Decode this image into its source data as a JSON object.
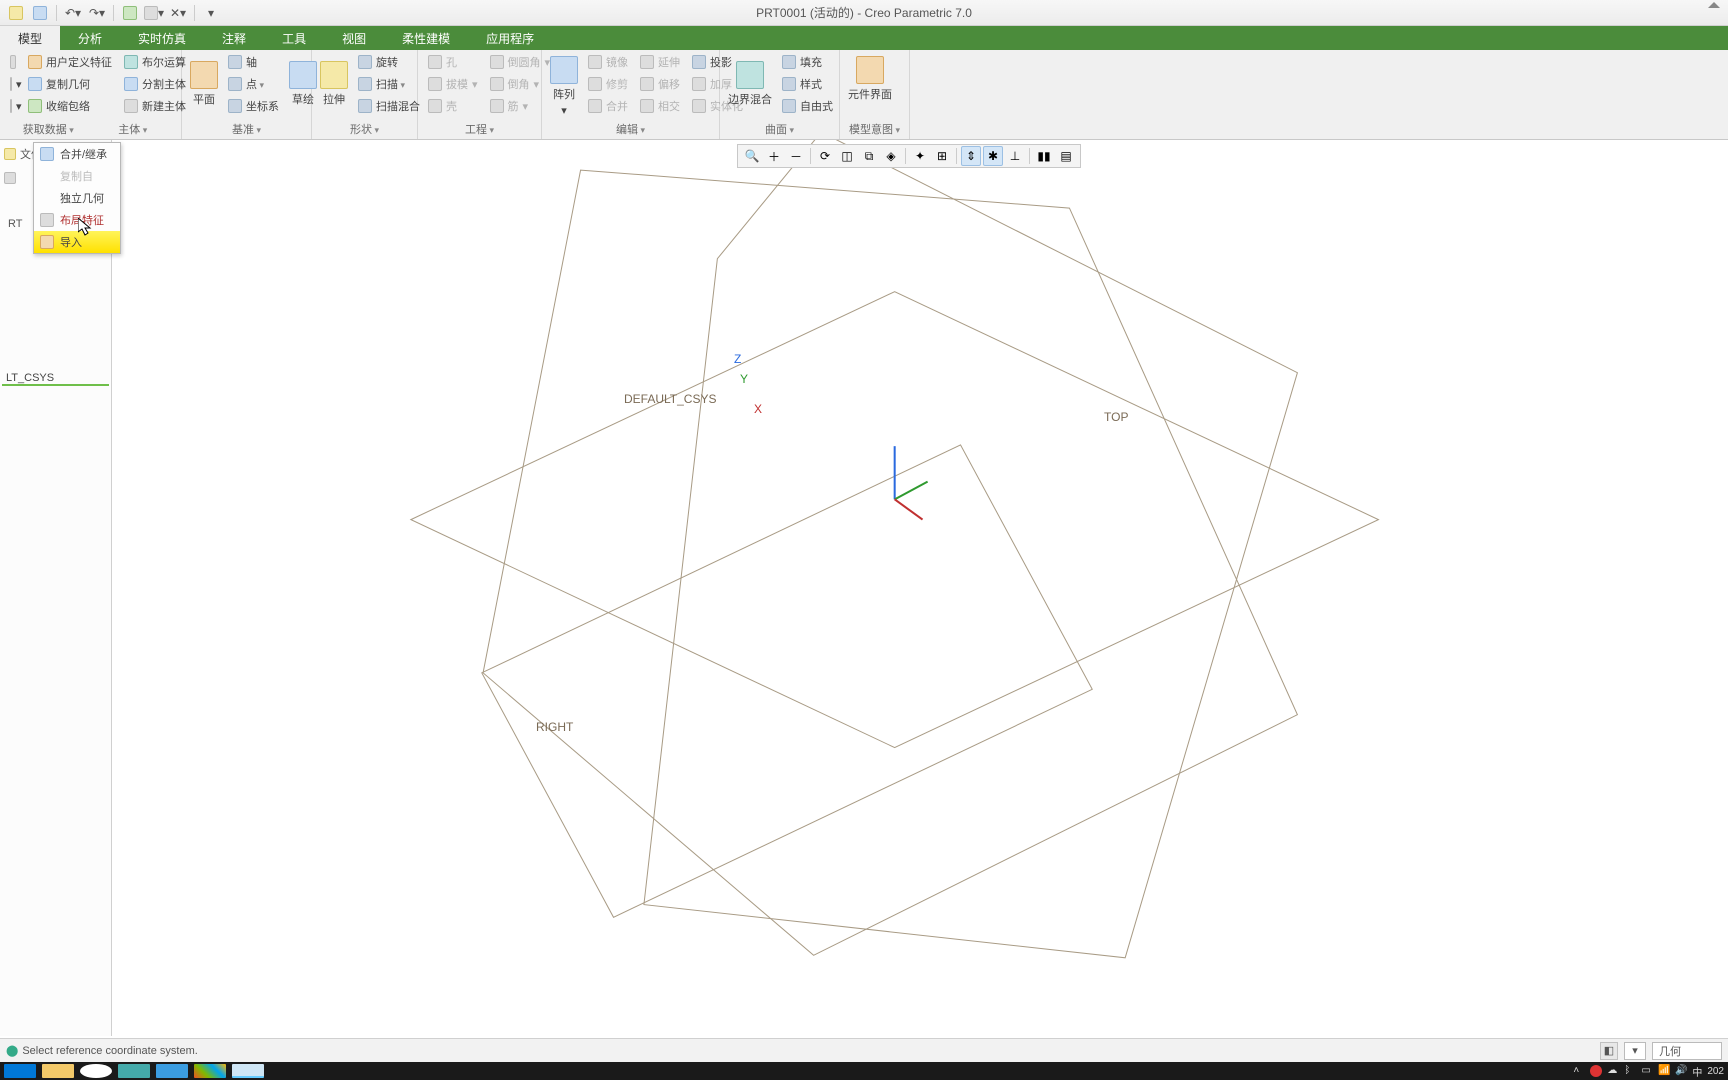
{
  "app": {
    "title": "PRT0001 (活动的) - Creo Parametric 7.0"
  },
  "tabs": {
    "items": [
      "模型",
      "分析",
      "实时仿真",
      "注释",
      "工具",
      "视图",
      "柔性建模",
      "应用程序"
    ],
    "active_index": 0
  },
  "ribbon": {
    "g0": {
      "r0": "用户定义特征",
      "r1": "复制几何",
      "r2": "收缩包络",
      "c0": "布尔运算",
      "c1": "分割主体",
      "c2": "新建主体",
      "label": "获取数据",
      "label2": "主体"
    },
    "g1": {
      "big": "平面",
      "r0": "轴",
      "r1": "点",
      "r2": "坐标系",
      "big2": "草绘",
      "label": "基准"
    },
    "g2": {
      "big": "拉伸",
      "r0": "旋转",
      "r1": "扫描",
      "r2": "扫描混合",
      "label": "形状"
    },
    "g3": {
      "r0": "孔",
      "r1": "拔模",
      "r2": "壳",
      "c0": "倒圆角",
      "c1": "倒角",
      "c2": "筋",
      "label": "工程"
    },
    "g4": {
      "big": "阵列",
      "r0": "镜像",
      "r1": "修剪",
      "r2": "合并",
      "c0": "延伸",
      "c1": "偏移",
      "c2": "相交",
      "d0": "投影",
      "d1": "加厚",
      "d2": "实体化",
      "label": "编辑"
    },
    "g5": {
      "big": "边界混合",
      "r0": "填充",
      "r1": "样式",
      "r2": "自由式",
      "label": "曲面"
    },
    "g6": {
      "big": "元件界面",
      "label": "模型意图"
    }
  },
  "dropdown": {
    "items": [
      {
        "label": "合并/继承",
        "enabled": true
      },
      {
        "label": "复制自",
        "enabled": false
      },
      {
        "label": "独立几何",
        "enabled": true
      },
      {
        "label": "布局特征",
        "enabled": true,
        "red": true
      },
      {
        "label": "导入",
        "enabled": true,
        "highlight": true
      }
    ]
  },
  "tree": {
    "header": "文件",
    "root": "RT",
    "csys": "LT_CSYS"
  },
  "canvas": {
    "csys_label": "DEFAULT_CSYS",
    "top": "TOP",
    "right": "RIGHT",
    "z": "Z",
    "y": "Y",
    "x": "X"
  },
  "status": {
    "message": "Select reference coordinate system.",
    "filter": "几何"
  },
  "taskbar": {
    "time_lang": "中",
    "year": "202"
  }
}
